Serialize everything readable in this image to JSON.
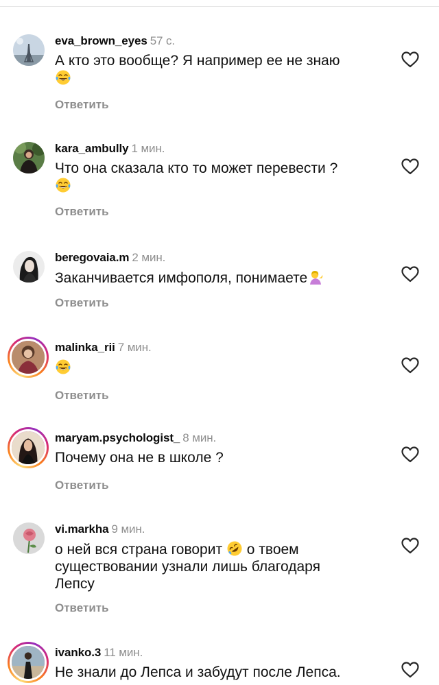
{
  "comments": [
    {
      "username": "eva_brown_eyes",
      "time": "57 с.",
      "text_lines": [
        "А кто это вообще? Я например ее не знаю"
      ],
      "trailing_emoji": "face-with-tears-of-joy-emoji",
      "reply_label": "Ответить",
      "avatar_icon": "eiffel-tower-avatar"
    },
    {
      "username": "kara_ambully",
      "time": "1 мин.",
      "text_lines": [
        "Что она сказала кто то может перевести ?"
      ],
      "trailing_emoji": "face-with-tears-of-joy-emoji",
      "reply_label": "Ответить",
      "avatar_icon": "woman-outdoor-avatar"
    },
    {
      "username": "beregovaia.m",
      "time": "2 мин.",
      "text_lines": [
        "Заканчивается имфополя, понимаете"
      ],
      "trailing_emoji": "person-tipping-hand-emoji",
      "reply_label": "Ответить",
      "avatar_icon": "woman-portrait-avatar"
    },
    {
      "username": "malinka_rii",
      "time": "7 мин.",
      "text_lines": [
        ""
      ],
      "trailing_emoji": "face-with-tears-of-joy-emoji",
      "reply_label": "Ответить",
      "avatar_icon": "story-avatar"
    },
    {
      "username": "maryam.psychologist_",
      "time": "8 мин.",
      "text_lines": [
        "Почему она не в школе ?"
      ],
      "trailing_emoji": "",
      "reply_label": "Ответить",
      "avatar_icon": "story-avatar"
    },
    {
      "username": "vi.markha",
      "time": "9 мин.",
      "text_lines": [
        "о ней вся страна говорит",
        "существовании узнали лишь благодаря",
        "Лепсу"
      ],
      "inline_after_first": "о твоем",
      "trailing_emoji": "rolling-on-floor-laughing-emoji",
      "reply_label": "Ответить",
      "avatar_icon": "rose-avatar"
    },
    {
      "username": "ivanko.3",
      "time": "11 мин.",
      "text_lines": [
        "Не знали до Лепса и забудут после Лепса."
      ],
      "trailing_emoji": "",
      "reply_label": "",
      "avatar_icon": "story-avatar"
    }
  ],
  "icons": {
    "like": "heart-outline-icon"
  },
  "colors": {
    "text": "#111111",
    "muted": "#8e8e8e",
    "story_ring_start": "#feda75",
    "story_ring_end": "#d62976"
  }
}
